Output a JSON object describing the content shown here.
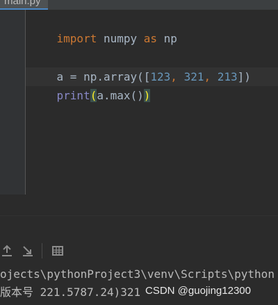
{
  "tab": {
    "label": "main.py"
  },
  "editor": {
    "line1": {
      "kw_import": "import",
      "module": " numpy ",
      "kw_as": "as",
      "alias": " np"
    },
    "line3": {
      "lhs": "a = np.array([",
      "n1": "123",
      "sep1": ", ",
      "n2": "321",
      "sep2": ", ",
      "n3": "213",
      "close": "])"
    },
    "line4": {
      "func": "print",
      "open": "(",
      "arg": "a.max()",
      "close": ")"
    }
  },
  "console": {
    "line1": "ojects\\pythonProject3\\venv\\Scripts\\python",
    "line2": "版本号 221.5787.24)321"
  },
  "watermark": "CSDN @guojing12300"
}
